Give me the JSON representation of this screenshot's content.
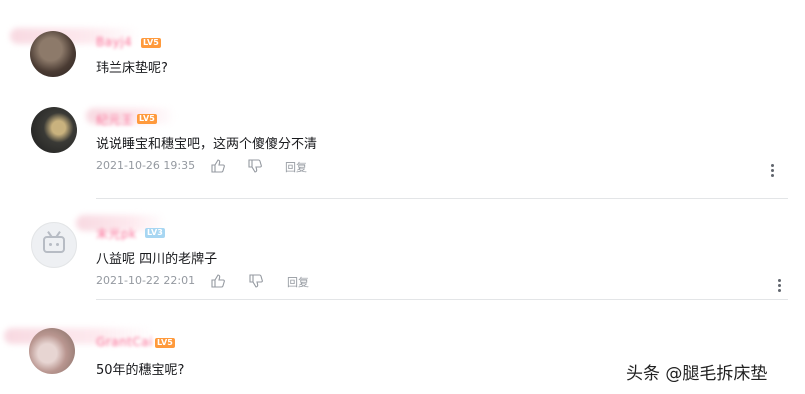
{
  "comments": [
    {
      "username": "Bayj4",
      "level": "LV5",
      "text": "玮兰床垫呢?"
    },
    {
      "username": "纪元王",
      "level": "LV5",
      "text": "说说睡宝和穗宝吧，这两个傻傻分不清",
      "date": "2021-10-26 19:35",
      "reply_label": "回复"
    },
    {
      "username": "末光pk",
      "level": "LV3",
      "text": "八益呢 四川的老牌子",
      "date": "2021-10-22 22:01",
      "reply_label": "回复"
    },
    {
      "username": "GrantCai",
      "level": "LV5",
      "text": "50年的穗宝呢?"
    }
  ],
  "watermark": "头条 @腿毛拆床垫"
}
